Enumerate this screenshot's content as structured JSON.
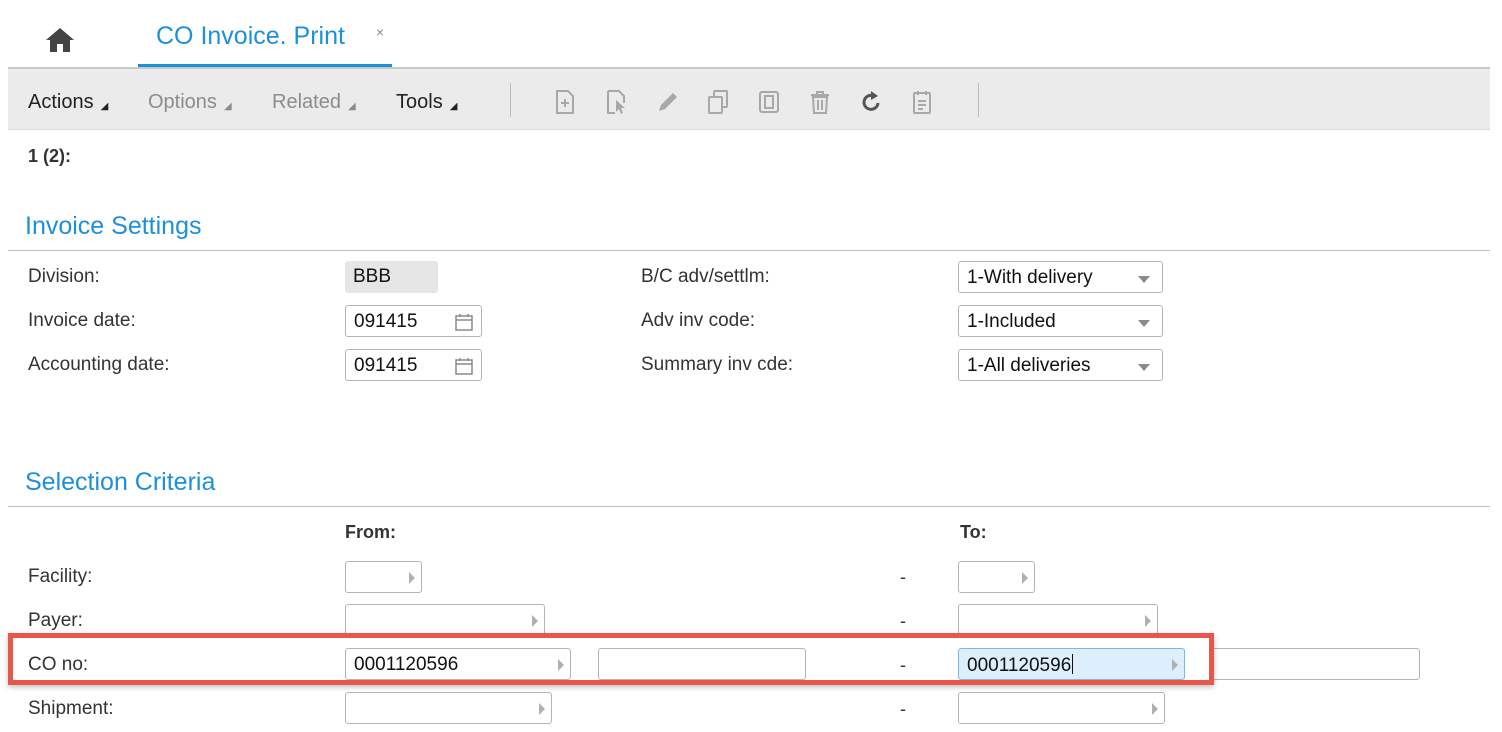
{
  "tab": {
    "title": "CO Invoice. Print",
    "close_glyph": "×"
  },
  "toolbar": {
    "menus": [
      {
        "label": "Actions",
        "enabled": true
      },
      {
        "label": "Options",
        "enabled": false
      },
      {
        "label": "Related",
        "enabled": false
      },
      {
        "label": "Tools",
        "enabled": true
      }
    ],
    "icons": [
      "new-icon",
      "select-icon",
      "edit-icon",
      "copy-icon",
      "duplicate-icon",
      "delete-icon",
      "refresh-icon",
      "notes-icon"
    ]
  },
  "record_counter": "1 (2):",
  "invoice_settings": {
    "title": "Invoice Settings",
    "division": {
      "label": "Division:",
      "value": "BBB"
    },
    "invoice_date": {
      "label": "Invoice date:",
      "value": "091415"
    },
    "accounting_date": {
      "label": "Accounting date:",
      "value": "091415"
    },
    "bc_adv_settlm": {
      "label": "B/C adv/settlm:",
      "value": "1-With delivery"
    },
    "adv_inv_code": {
      "label": "Adv inv code:",
      "value": "1-Included"
    },
    "summary_inv_code": {
      "label": "Summary inv cde:",
      "value": "1-All deliveries"
    }
  },
  "selection_criteria": {
    "title": "Selection Criteria",
    "from_label": "From:",
    "to_label": "To:",
    "range_separator": "-",
    "facility": {
      "label": "Facility:",
      "from": "",
      "to": ""
    },
    "payer": {
      "label": "Payer:",
      "from": "",
      "to": ""
    },
    "co_no": {
      "label": "CO no:",
      "from": "0001120596",
      "from_extra": "",
      "to": "0001120596",
      "to_extra": ""
    },
    "shipment": {
      "label": "Shipment:",
      "from": "",
      "to": ""
    }
  },
  "colors": {
    "accent": "#1e90d8",
    "highlight": "#e8574a"
  }
}
